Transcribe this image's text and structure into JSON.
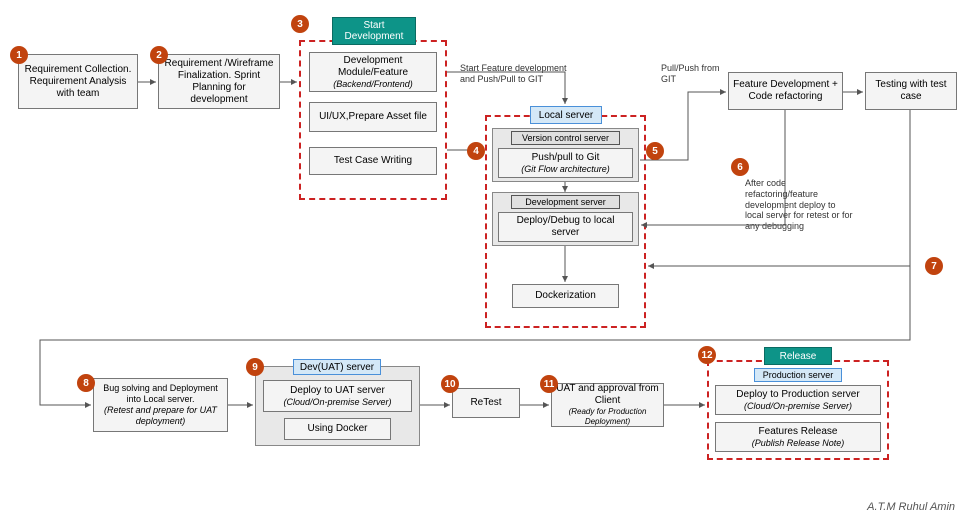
{
  "boxes": {
    "req_collection": "Requirement Collection.\nRequirement Analysis with team",
    "req_wireframe": "Requirement /Wireframe Finalization.\nSprint Planning for development",
    "start_dev_header": "Start Development",
    "dev_module": "Development Module/Feature",
    "dev_module_sub": "(Backend/Frontend)",
    "uiux": "UI/UX,Prepare Asset file",
    "test_case": "Test Case Writing",
    "local_server_header": "Local server",
    "vcs_header": "Version control server",
    "push_pull": "Push/pull to Git",
    "push_pull_sub": "(Git Flow architecture)",
    "dev_server_header": "Development server",
    "deploy_local": "Deploy/Debug to local server",
    "dockerization": "Dockerization",
    "feat_dev": "Feature Development + Code refactoring",
    "testing": "Testing with test case",
    "bug_solve": "Bug solving and Deployment into Local server.",
    "bug_solve_sub": "(Retest and prepare for UAT deployment)",
    "uat_header": "Dev(UAT) server",
    "deploy_uat": "Deploy to UAT server",
    "deploy_uat_sub": "(Cloud/On-premise Server)",
    "using_docker": "Using Docker",
    "retest": "ReTest",
    "uat_approval": "UAT and approval from Client",
    "uat_approval_sub": "(Ready for Production Deployment)",
    "release_header": "Release",
    "prod_header": "Production server",
    "deploy_prod": "Deploy to Production server",
    "deploy_prod_sub": "(Cloud/On-premise Server)",
    "feat_release": "Features Release",
    "feat_release_sub": "(Publish Release Note)"
  },
  "notes": {
    "start_feature": "Start Feature development and Push/Pull to GIT",
    "pull_push_git": "Pull/Push from GIT",
    "after_refactor": "After code refactoring/feature development deploy to local server for retest or for any debugging"
  },
  "badges": {
    "b1": "1",
    "b2": "2",
    "b3": "3",
    "b4": "4",
    "b5": "5",
    "b6": "6",
    "b7": "7",
    "b8": "8",
    "b9": "9",
    "b10": "10",
    "b11": "11",
    "b12": "12"
  },
  "credit": "A.T.M Ruhul Amin"
}
